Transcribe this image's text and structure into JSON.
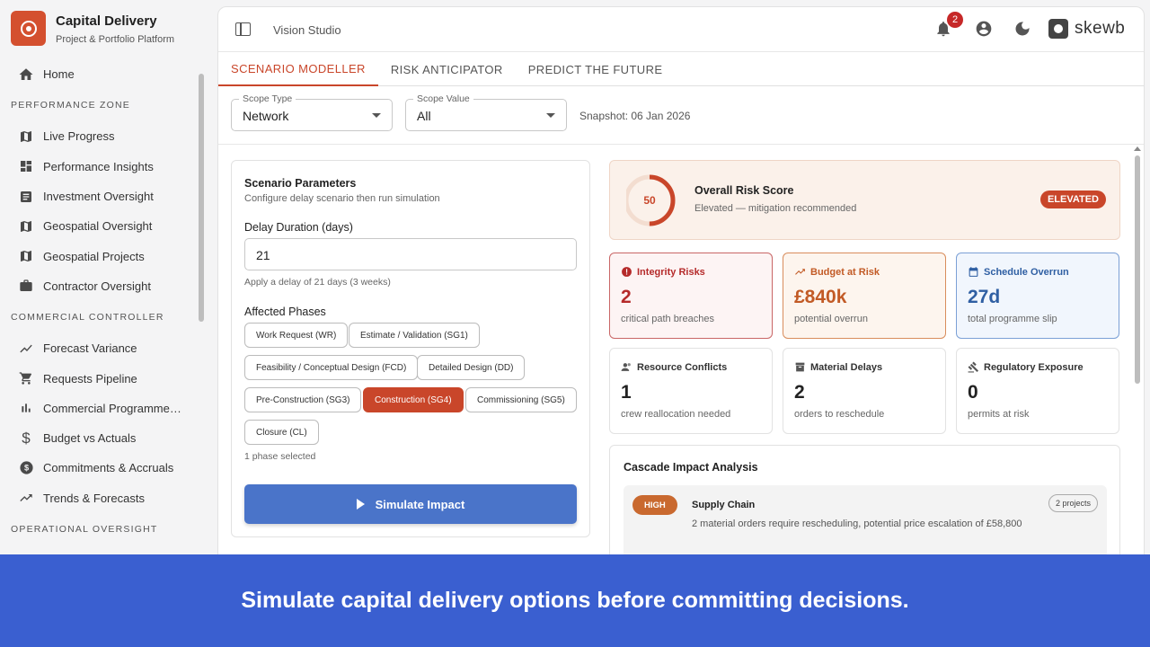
{
  "brand": {
    "title": "Capital Delivery",
    "subtitle": "Project & Portfolio Platform",
    "accent": "#d4502f"
  },
  "sidebar": {
    "home": "Home",
    "sections": [
      {
        "title": "PERFORMANCE ZONE",
        "items": [
          {
            "label": "Live Progress",
            "icon": "map-icon"
          },
          {
            "label": "Performance Insights",
            "icon": "dashboard-icon"
          },
          {
            "label": "Investment Oversight",
            "icon": "document-icon"
          },
          {
            "label": "Geospatial Oversight",
            "icon": "map-icon"
          },
          {
            "label": "Geospatial Projects",
            "icon": "map-icon"
          },
          {
            "label": "Contractor Oversight",
            "icon": "briefcase-icon"
          }
        ]
      },
      {
        "title": "COMMERCIAL CONTROLLER",
        "items": [
          {
            "label": "Forecast Variance",
            "icon": "trend-icon"
          },
          {
            "label": "Requests Pipeline",
            "icon": "cart-icon"
          },
          {
            "label": "Commercial Programme…",
            "icon": "bar-chart-icon"
          },
          {
            "label": "Budget vs Actuals",
            "icon": "dollar-icon"
          },
          {
            "label": "Commitments & Accruals",
            "icon": "dollar-circle-icon"
          },
          {
            "label": "Trends & Forecasts",
            "icon": "trend-up-icon"
          }
        ]
      },
      {
        "title": "OPERATIONAL OVERSIGHT",
        "items": []
      }
    ]
  },
  "topbar": {
    "breadcrumb": "Vision Studio",
    "notifications": "2",
    "logo_text": "skewb"
  },
  "tabs": [
    {
      "label": "SCENARIO MODELLER",
      "active": true
    },
    {
      "label": "RISK ANTICIPATOR",
      "active": false
    },
    {
      "label": "PREDICT THE FUTURE",
      "active": false
    }
  ],
  "filters": {
    "scope_type": {
      "label": "Scope Type",
      "value": "Network"
    },
    "scope_value": {
      "label": "Scope Value",
      "value": "All"
    },
    "snapshot": "Snapshot: 06 Jan 2026"
  },
  "scenario": {
    "title": "Scenario Parameters",
    "subtitle": "Configure delay scenario then run simulation",
    "delay_label": "Delay Duration (days)",
    "delay_value": "21",
    "delay_help": "Apply a delay of 21 days (3 weeks)",
    "phases_label": "Affected Phases",
    "phases": [
      {
        "label": "Work Request (WR)",
        "selected": false
      },
      {
        "label": "Estimate / Validation (SG1)",
        "selected": false
      },
      {
        "label": "Feasibility / Conceptual Design (FCD)",
        "selected": false
      },
      {
        "label": "Detailed Design (DD)",
        "selected": false
      },
      {
        "label": "Pre-Construction (SG3)",
        "selected": false
      },
      {
        "label": "Construction (SG4)",
        "selected": true
      },
      {
        "label": "Commissioning (SG5)",
        "selected": false
      },
      {
        "label": "Closure (CL)",
        "selected": false
      }
    ],
    "phase_count": "1 phase selected",
    "simulate_label": "Simulate Impact"
  },
  "risk_score": {
    "value": "50",
    "fraction": 0.5,
    "title": "Overall Risk Score",
    "subtitle": "Elevated — mitigation recommended",
    "badge": "ELEVATED"
  },
  "kpis": [
    {
      "title": "Integrity Risks",
      "value": "2",
      "sub": "critical path breaches",
      "tone": "red",
      "icon": "alert-icon"
    },
    {
      "title": "Budget at Risk",
      "value": "£840k",
      "sub": "potential overrun",
      "tone": "orange",
      "icon": "trend-up-icon"
    },
    {
      "title": "Schedule Overrun",
      "value": "27d",
      "sub": "total programme slip",
      "tone": "blue",
      "icon": "calendar-icon"
    },
    {
      "title": "Resource Conflicts",
      "value": "1",
      "sub": "crew reallocation needed",
      "tone": "plain",
      "icon": "people-icon"
    },
    {
      "title": "Material Delays",
      "value": "2",
      "sub": "orders to reschedule",
      "tone": "plain",
      "icon": "box-icon"
    },
    {
      "title": "Regulatory Exposure",
      "value": "0",
      "sub": "permits at risk",
      "tone": "plain",
      "icon": "gavel-icon"
    }
  ],
  "cascade": {
    "title": "Cascade Impact Analysis",
    "items": [
      {
        "severity": "HIGH",
        "title": "Supply Chain",
        "description": "2 material orders require rescheduling, potential price escalation of £58,800",
        "projects": "2 projects"
      }
    ]
  },
  "banner": {
    "text": "Simulate capital delivery options before committing decisions."
  }
}
